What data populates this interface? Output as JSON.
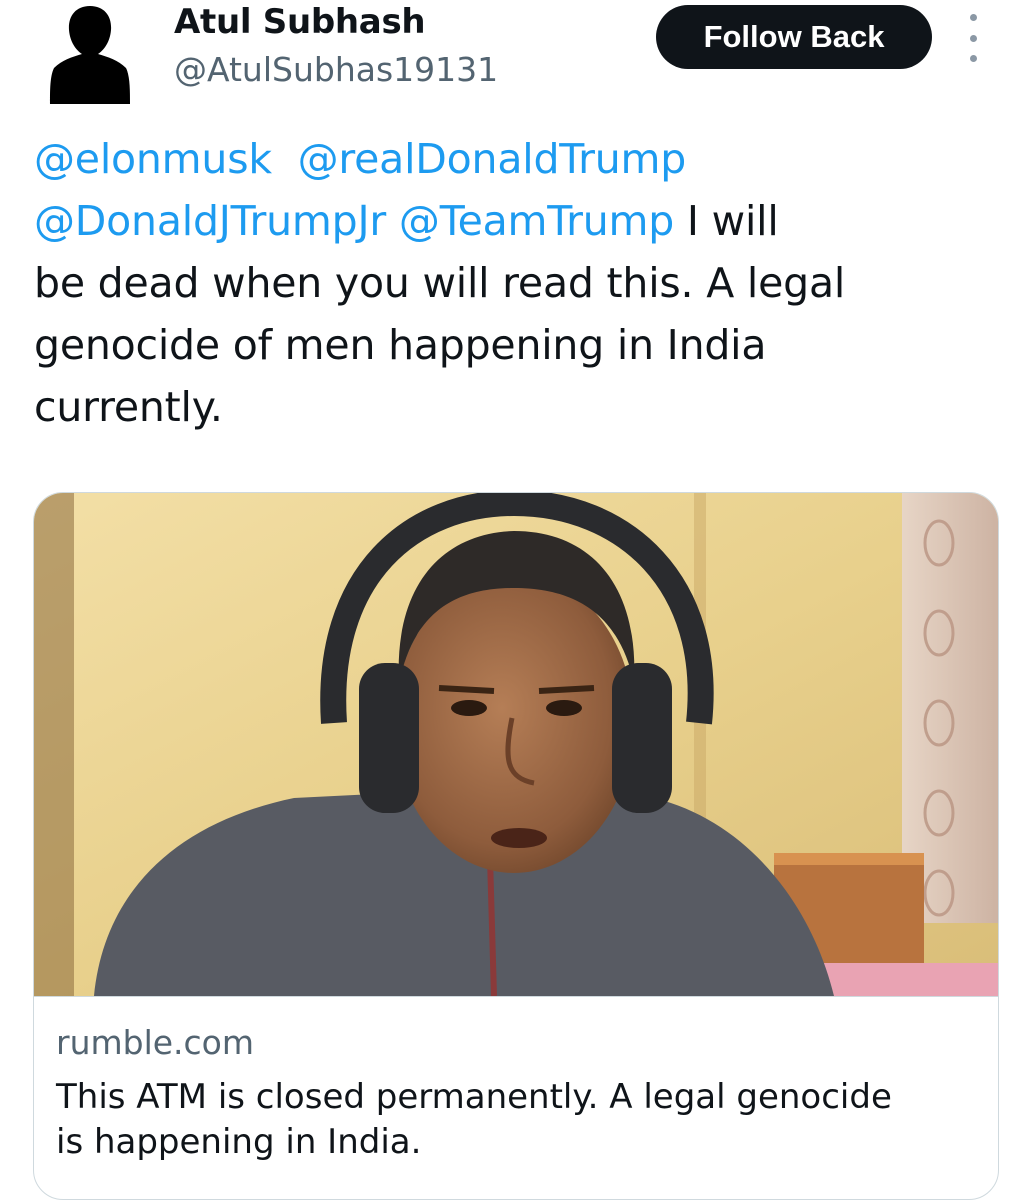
{
  "tweet": {
    "author": {
      "name": "Atul Subhash",
      "handle": "@AtulSubhas19131",
      "avatar_icon": "user-silhouette-icon"
    },
    "follow_button_label": "Follow Back",
    "more_icon": "more-vertical-icon",
    "text_lines": [
      [
        {
          "type": "mention",
          "text": "@elonmusk"
        },
        {
          "type": "text",
          "text": "  "
        },
        {
          "type": "mention",
          "text": "@realDonaldTrump"
        }
      ],
      [
        {
          "type": "mention",
          "text": "@DonaldJTrumpJr"
        },
        {
          "type": "text",
          "text": " "
        },
        {
          "type": "mention",
          "text": "@TeamTrump"
        },
        {
          "type": "text",
          "text": " I will"
        }
      ],
      [
        {
          "type": "text",
          "text": "be dead when you will read this. A legal"
        }
      ],
      [
        {
          "type": "text",
          "text": "genocide of men happening in India"
        }
      ],
      [
        {
          "type": "text",
          "text": "currently."
        }
      ]
    ],
    "link_card": {
      "domain": "rumble.com",
      "title_lines": [
        "This ATM is closed permanently. A legal genocide",
        "is happening in India."
      ]
    }
  },
  "colors": {
    "text_primary": "#0f1419",
    "text_secondary": "#536471",
    "link": "#1d9bf0",
    "button_bg": "#0f1419",
    "button_text": "#ffffff",
    "card_border": "#cfd9de"
  }
}
